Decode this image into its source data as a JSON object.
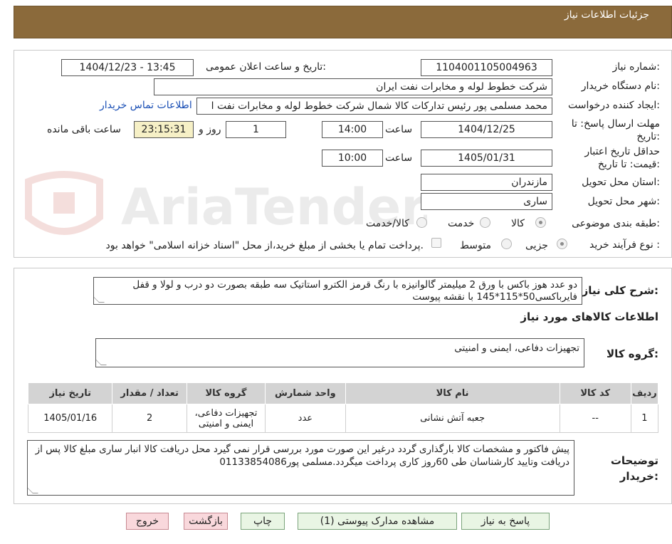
{
  "header": {
    "title": "جزئیات اطلاعات نیاز"
  },
  "form": {
    "need_number_label": "شماره نیاز:",
    "need_number": "1104001105004963",
    "announce_label": "تاریخ و ساعت اعلان عمومی:",
    "announce_value": "1404/12/23 - 13:45",
    "buyer_org_label": "نام دستگاه خریدار:",
    "buyer_org": "شرکت خطوط لوله و مخابرات نفت ایران",
    "creator_label": "ایجاد کننده درخواست:",
    "creator": "محمد مسلمی پور رئیس تدارکات کالا شمال شرکت خطوط لوله و مخابرات نفت ا",
    "contact_link": "اطلاعات تماس خریدار",
    "reply_deadline_label": "مهلت ارسال پاسخ: تا تاریخ:",
    "reply_date": "1404/12/25",
    "time_label": "ساعت",
    "reply_time": "14:00",
    "days_value": "1",
    "days_label": "روز و",
    "remaining_time": "23:15:31",
    "remaining_label": "ساعت باقی مانده",
    "validity_label": "حداقل تاریخ اعتبار قیمت: تا تاریخ:",
    "validity_date": "1405/01/31",
    "validity_time": "10:00",
    "province_label": "استان محل تحویل:",
    "province": "مازندران",
    "city_label": "شهر محل تحویل:",
    "city": "ساری",
    "category_label": "طبقه بندی موضوعی:",
    "category_options": [
      "کالا",
      "خدمت",
      "کالا/خدمت"
    ],
    "process_label": "نوع فرآیند خرید :",
    "process_options": [
      "جزیی",
      "متوسط"
    ],
    "payment_note": "پرداخت تمام یا بخشی از مبلغ خرید،از محل \"اسناد خزانه اسلامی\" خواهد بود."
  },
  "description": {
    "label": "شرح کلی نیاز:",
    "text": "دو عدد هوز باکس با ورق 2 میلیمتر گالوانیزه با رنگ قرمز الکترو استاتیک سه طبقه بصورت دو درب و لولا و قفل فایرباکسی50*115*145 با نقشه پیوست"
  },
  "goods": {
    "section_title": "اطلاعات کالاهای مورد نیاز",
    "group_label": "گروه کالا:",
    "group_value": "تجهیزات دفاعی، ایمنی و امنیتی",
    "columns": [
      "ردیف",
      "کد کالا",
      "نام کالا",
      "واحد شمارش",
      "گروه کالا",
      "تعداد / مقدار",
      "تاریخ نیاز"
    ],
    "rows": [
      {
        "row": "1",
        "code": "--",
        "name": "جعبه آتش نشانی",
        "unit": "عدد",
        "group": "تجهیزات دفاعی، ایمنی و امنیتی",
        "qty": "2",
        "date": "1405/01/16"
      }
    ]
  },
  "buyer_notes": {
    "label": "توضیحات خریدار:",
    "text": "پیش فاکتور و مشخصات کالا بارگذاری گردد درغیر این صورت مورد بررسی قرار نمی گیرد محل دریافت کالا انبار ساری مبلغ کالا پس از دریافت وتایید کارشناسان طی 60روز کاری پرداخت میگردد.مسلمی پور01133854086"
  },
  "buttons": {
    "reply": "پاسخ به نیاز",
    "attachments": "مشاهده مدارک پیوستی (1)",
    "print": "چاپ",
    "back": "بازگشت",
    "exit": "خروج"
  },
  "colors": {
    "header": "#8b6a3b",
    "button_green": "#e9f5e4",
    "button_pink": "#f9d8dc",
    "remaining_bg": "#f6f0c6"
  },
  "watermark": "AriaTender.net"
}
